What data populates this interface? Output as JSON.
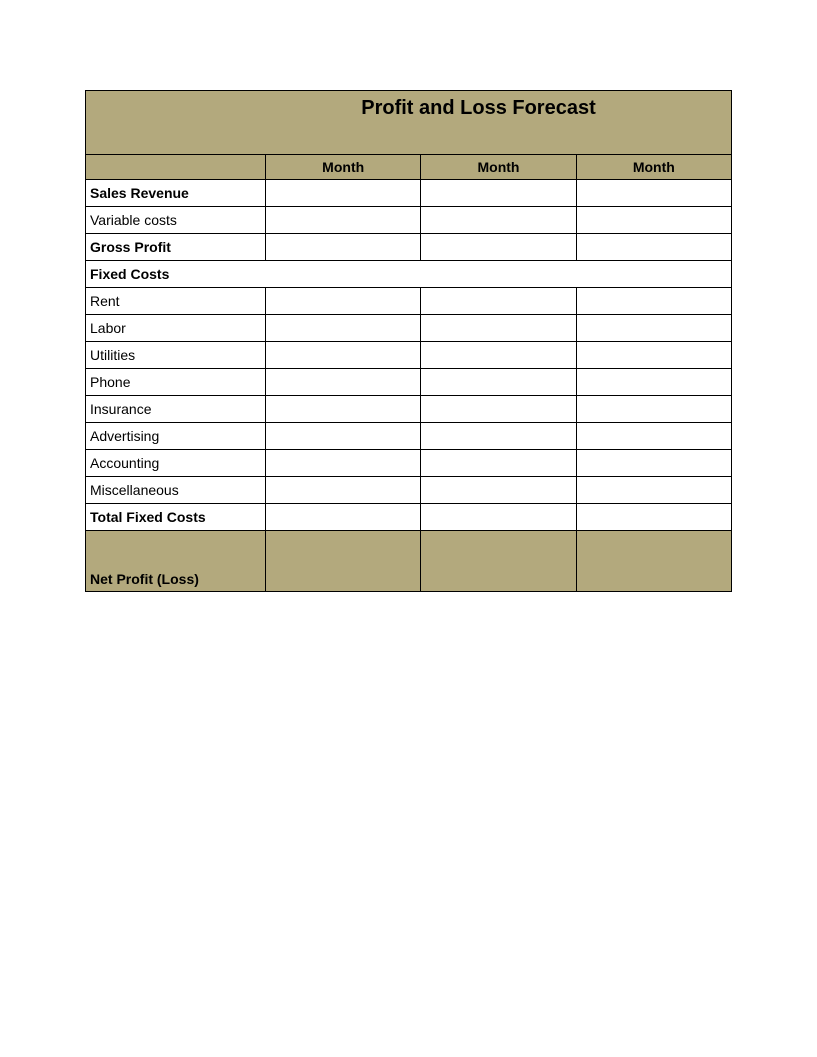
{
  "title": "Profit and Loss Forecast",
  "columns": {
    "label": "",
    "month1": "Month",
    "month2": "Month",
    "month3": "Month"
  },
  "rows": {
    "sales_revenue": {
      "label": "Sales Revenue",
      "values": [
        "",
        "",
        ""
      ]
    },
    "variable_costs": {
      "label": "Variable costs",
      "values": [
        "",
        "",
        ""
      ]
    },
    "gross_profit": {
      "label": "Gross Profit",
      "values": [
        "",
        "",
        ""
      ]
    },
    "fixed_costs_header": "Fixed Costs",
    "rent": {
      "label": "Rent",
      "values": [
        "",
        "",
        ""
      ]
    },
    "labor": {
      "label": "Labor",
      "values": [
        "",
        "",
        ""
      ]
    },
    "utilities": {
      "label": "Utilities",
      "values": [
        "",
        "",
        ""
      ]
    },
    "phone": {
      "label": "Phone",
      "values": [
        "",
        "",
        ""
      ]
    },
    "insurance": {
      "label": "Insurance",
      "values": [
        "",
        "",
        ""
      ]
    },
    "advertising": {
      "label": "Advertising",
      "values": [
        "",
        "",
        ""
      ]
    },
    "accounting": {
      "label": "Accounting",
      "values": [
        "",
        "",
        ""
      ]
    },
    "miscellaneous": {
      "label": "Miscellaneous",
      "values": [
        "",
        "",
        ""
      ]
    },
    "total_fixed_costs": {
      "label": "Total Fixed Costs",
      "values": [
        "",
        "",
        ""
      ]
    },
    "net_profit": {
      "label": "Net Profit (Loss)",
      "values": [
        "",
        "",
        ""
      ]
    }
  }
}
